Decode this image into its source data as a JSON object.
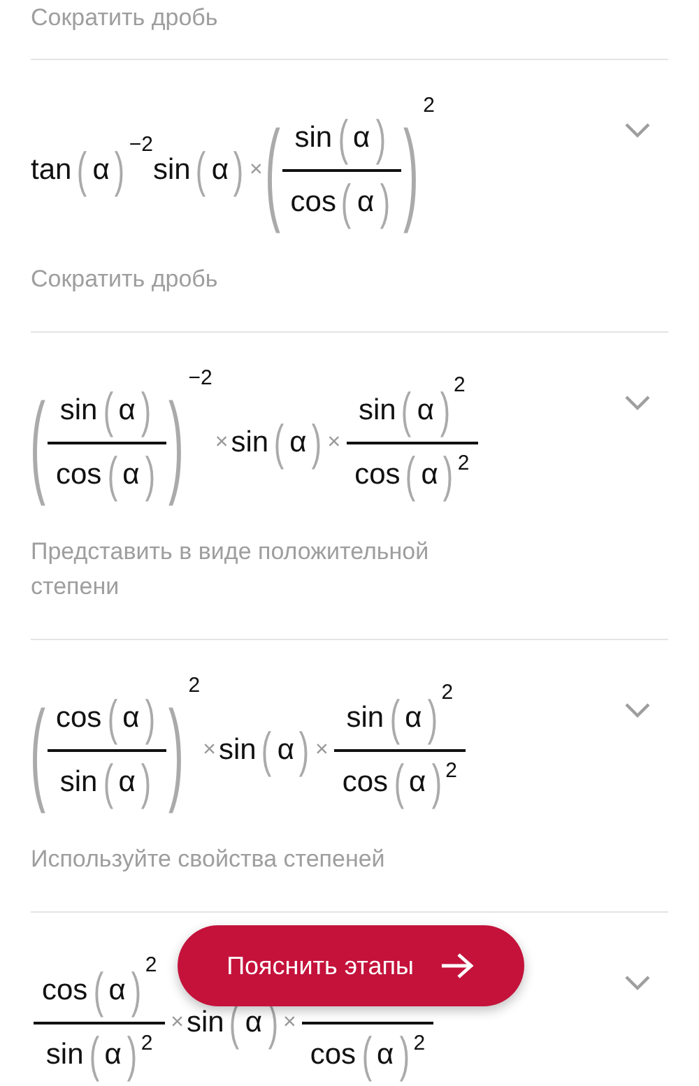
{
  "steps": [
    {
      "hint": "Сократить дробь"
    },
    {
      "expression": [
        {
          "kind": "fn",
          "name": "tan",
          "parens": [
            "(",
            ")"
          ],
          "arg": "α",
          "sup": "−2"
        },
        {
          "kind": "fn",
          "name": "sin",
          "parens": [
            "(",
            ")"
          ],
          "arg": "α"
        },
        {
          "kind": "op",
          "text": "×"
        },
        {
          "kind": "frac",
          "parens": [
            "(",
            ")"
          ],
          "sup": "2",
          "num": [
            {
              "kind": "fn",
              "name": "sin",
              "parens": [
                "(",
                ")"
              ],
              "arg": "α"
            }
          ],
          "den": [
            {
              "kind": "fn",
              "name": "cos",
              "parens": [
                "(",
                ")"
              ],
              "arg": "α"
            }
          ]
        }
      ],
      "hint": "Сократить дробь"
    },
    {
      "expression": [
        {
          "kind": "frac",
          "parens": [
            "(",
            ")"
          ],
          "sup": "−2",
          "num": [
            {
              "kind": "fn",
              "name": "sin",
              "parens": [
                "(",
                ")"
              ],
              "arg": "α"
            }
          ],
          "den": [
            {
              "kind": "fn",
              "name": "cos",
              "parens": [
                "(",
                ")"
              ],
              "arg": "α"
            }
          ]
        },
        {
          "kind": "op",
          "text": "×"
        },
        {
          "kind": "fn",
          "name": "sin",
          "parens": [
            "(",
            ")"
          ],
          "arg": "α"
        },
        {
          "kind": "op",
          "text": "×"
        },
        {
          "kind": "frac",
          "num": [
            {
              "kind": "fn",
              "name": "sin",
              "parens": [
                "(",
                ")"
              ],
              "arg": "α",
              "sup": "2"
            }
          ],
          "den": [
            {
              "kind": "fn",
              "name": "cos",
              "parens": [
                "(",
                ")"
              ],
              "arg": "α",
              "sup": "2"
            }
          ]
        }
      ],
      "hint": "Представить в виде положительной степени"
    },
    {
      "expression": [
        {
          "kind": "frac",
          "parens": [
            "(",
            ")"
          ],
          "sup": "2",
          "num": [
            {
              "kind": "fn",
              "name": "cos",
              "parens": [
                "(",
                ")"
              ],
              "arg": "α"
            }
          ],
          "den": [
            {
              "kind": "fn",
              "name": "sin",
              "parens": [
                "(",
                ")"
              ],
              "arg": "α"
            }
          ]
        },
        {
          "kind": "op",
          "text": "×"
        },
        {
          "kind": "fn",
          "name": "sin",
          "parens": [
            "(",
            ")"
          ],
          "arg": "α"
        },
        {
          "kind": "op",
          "text": "×"
        },
        {
          "kind": "frac",
          "num": [
            {
              "kind": "fn",
              "name": "sin",
              "parens": [
                "(",
                ")"
              ],
              "arg": "α",
              "sup": "2"
            }
          ],
          "den": [
            {
              "kind": "fn",
              "name": "cos",
              "parens": [
                "(",
                ")"
              ],
              "arg": "α",
              "sup": "2"
            }
          ]
        }
      ],
      "hint": "Используйте свойства степеней"
    },
    {
      "expression": [
        {
          "kind": "frac",
          "num": [
            {
              "kind": "fn",
              "name": "cos",
              "parens": [
                "(",
                ")"
              ],
              "arg": "α",
              "sup": "2"
            }
          ],
          "den": [
            {
              "kind": "fn",
              "name": "sin",
              "parens": [
                "(",
                ")"
              ],
              "arg": "α",
              "sup": "2"
            }
          ]
        },
        {
          "kind": "op",
          "text": "×"
        },
        {
          "kind": "fn",
          "name": "sin",
          "parens": [
            "(",
            ")"
          ],
          "arg": "α"
        },
        {
          "kind": "op",
          "text": "×"
        },
        {
          "kind": "frac",
          "den": [
            {
              "kind": "fn",
              "name": "cos",
              "parens": [
                "(",
                ")"
              ],
              "arg": "α",
              "sup": "2"
            }
          ]
        }
      ]
    }
  ],
  "explain_button": {
    "label": "Пояснить этапы"
  }
}
